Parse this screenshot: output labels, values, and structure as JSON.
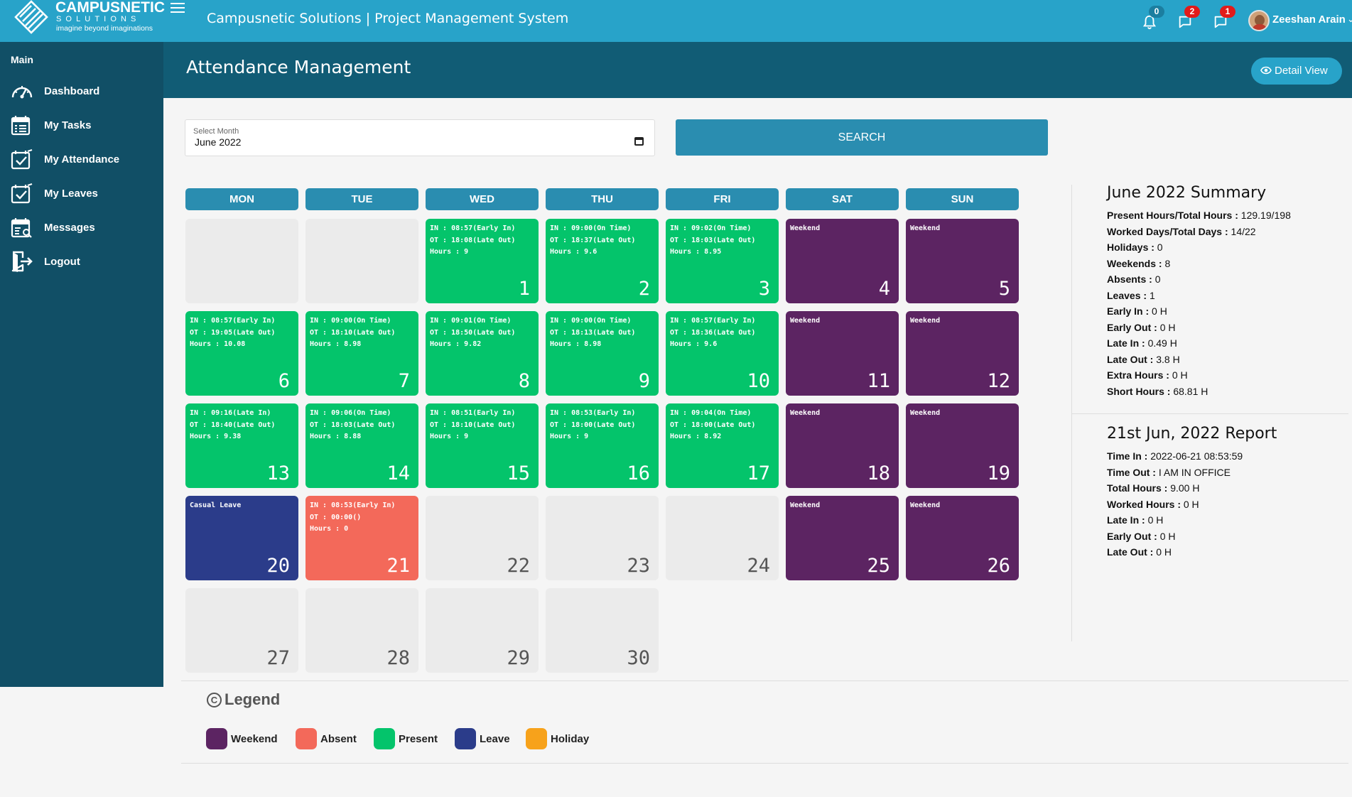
{
  "brand": {
    "name": "CAMPUSNETIC",
    "sub": "SOLUTIONS",
    "tagline": "imagine beyond imaginations"
  },
  "header": {
    "app_title": "Campusnetic Solutions | Project Management System",
    "notifications": [
      {
        "icon": "bell-icon",
        "count": "0",
        "color": "#1b7ea0"
      },
      {
        "icon": "chat-icon",
        "count": "2",
        "color": "#e21a1a"
      },
      {
        "icon": "chat-icon",
        "count": "1",
        "color": "#e21a1a"
      }
    ],
    "user_name": "Zeeshan Arain",
    "user_chevron": "⌄"
  },
  "sidebar": {
    "section": "Main",
    "items": [
      {
        "label": "Dashboard",
        "icon": "speedometer-icon"
      },
      {
        "label": "My Tasks",
        "icon": "calendar-list-icon"
      },
      {
        "label": "My Attendance",
        "icon": "calendar-check-icon"
      },
      {
        "label": "My Leaves",
        "icon": "calendar-check-icon"
      },
      {
        "label": "Messages",
        "icon": "calendar-search-icon"
      },
      {
        "label": "Logout",
        "icon": "logout-icon"
      }
    ]
  },
  "page": {
    "title": "Attendance Management",
    "detail_button": "Detail View"
  },
  "filter": {
    "month_label": "Select Month",
    "month_value": "June 2022",
    "search_label": "SEARCH"
  },
  "calendar": {
    "days": [
      "MON",
      "TUE",
      "WED",
      "THU",
      "FRI",
      "SAT",
      "SUN"
    ],
    "cells": [
      {
        "type": "empty",
        "day": "",
        "info": ""
      },
      {
        "type": "empty",
        "day": "",
        "info": ""
      },
      {
        "type": "present",
        "day": "1",
        "info": "IN : 08:57(Early In)\nOT : 18:08(Late Out)\nHours : 9"
      },
      {
        "type": "present",
        "day": "2",
        "info": "IN : 09:00(On Time)\nOT : 18:37(Late Out)\nHours : 9.6"
      },
      {
        "type": "present",
        "day": "3",
        "info": "IN : 09:02(On Time)\nOT : 18:03(Late Out)\nHours : 8.95"
      },
      {
        "type": "weekend",
        "day": "4",
        "info": "Weekend"
      },
      {
        "type": "weekend",
        "day": "5",
        "info": "Weekend"
      },
      {
        "type": "present",
        "day": "6",
        "info": "IN : 08:57(Early In)\nOT : 19:05(Late Out)\nHours : 10.08"
      },
      {
        "type": "present",
        "day": "7",
        "info": "IN : 09:00(On Time)\nOT : 18:10(Late Out)\nHours : 8.98"
      },
      {
        "type": "present",
        "day": "8",
        "info": "IN : 09:01(On Time)\nOT : 18:50(Late Out)\nHours : 9.82"
      },
      {
        "type": "present",
        "day": "9",
        "info": "IN : 09:00(On Time)\nOT : 18:13(Late Out)\nHours : 8.98"
      },
      {
        "type": "present",
        "day": "10",
        "info": "IN : 08:57(Early In)\nOT : 18:36(Late Out)\nHours : 9.6"
      },
      {
        "type": "weekend",
        "day": "11",
        "info": "Weekend"
      },
      {
        "type": "weekend",
        "day": "12",
        "info": "Weekend"
      },
      {
        "type": "present",
        "day": "13",
        "info": "IN : 09:16(Late In)\nOT : 18:40(Late Out)\nHours : 9.38"
      },
      {
        "type": "present",
        "day": "14",
        "info": "IN : 09:06(On Time)\nOT : 18:03(Late Out)\nHours : 8.88"
      },
      {
        "type": "present",
        "day": "15",
        "info": "IN : 08:51(Early In)\nOT : 18:10(Late Out)\nHours : 9"
      },
      {
        "type": "present",
        "day": "16",
        "info": "IN : 08:53(Early In)\nOT : 18:00(Late Out)\nHours : 9"
      },
      {
        "type": "present",
        "day": "17",
        "info": "IN : 09:04(On Time)\nOT : 18:00(Late Out)\nHours : 8.92"
      },
      {
        "type": "weekend",
        "day": "18",
        "info": "Weekend"
      },
      {
        "type": "weekend",
        "day": "19",
        "info": "Weekend"
      },
      {
        "type": "leave",
        "day": "20",
        "info": "Casual Leave"
      },
      {
        "type": "absent",
        "day": "21",
        "info": "IN : 08:53(Early In)\nOT : 00:00()\nHours : 0"
      },
      {
        "type": "future",
        "day": "22",
        "info": ""
      },
      {
        "type": "future",
        "day": "23",
        "info": ""
      },
      {
        "type": "future",
        "day": "24",
        "info": ""
      },
      {
        "type": "weekend",
        "day": "25",
        "info": "Weekend"
      },
      {
        "type": "weekend",
        "day": "26",
        "info": "Weekend"
      },
      {
        "type": "future",
        "day": "27",
        "info": ""
      },
      {
        "type": "future",
        "day": "28",
        "info": ""
      },
      {
        "type": "future",
        "day": "29",
        "info": ""
      },
      {
        "type": "future",
        "day": "30",
        "info": ""
      }
    ]
  },
  "summary": {
    "title": "June 2022 Summary",
    "rows": [
      {
        "label": "Present Hours/Total Hours :",
        "value": "129.19/198"
      },
      {
        "label": "Worked Days/Total Days :",
        "value": "14/22"
      },
      {
        "label": "Holidays :",
        "value": "0"
      },
      {
        "label": "Weekends :",
        "value": "8"
      },
      {
        "label": "Absents :",
        "value": "0"
      },
      {
        "label": "Leaves :",
        "value": "1"
      },
      {
        "label": "Early In :",
        "value": "0 H"
      },
      {
        "label": "Early Out :",
        "value": "0 H"
      },
      {
        "label": "Late In :",
        "value": "0.49 H"
      },
      {
        "label": "Late Out :",
        "value": "3.8 H"
      },
      {
        "label": "Extra Hours :",
        "value": "0 H"
      },
      {
        "label": "Short Hours :",
        "value": "68.81 H"
      }
    ]
  },
  "report": {
    "title": "21st Jun, 2022 Report",
    "rows": [
      {
        "label": "Time In :",
        "value": "2022-06-21 08:53:59"
      },
      {
        "label": "Time Out :",
        "value": "I AM IN OFFICE"
      },
      {
        "label": "Total Hours :",
        "value": "9.00 H"
      },
      {
        "label": "Worked Hours :",
        "value": "0 H"
      },
      {
        "label": "Late In :",
        "value": "0 H"
      },
      {
        "label": "Early Out :",
        "value": "0 H"
      },
      {
        "label": "Late Out :",
        "value": "0 H"
      }
    ]
  },
  "legend": {
    "title": "Legend",
    "symbol": "C",
    "items": [
      {
        "label": "Weekend",
        "color": "#5c2462"
      },
      {
        "label": "Absent",
        "color": "#f3695a"
      },
      {
        "label": "Present",
        "color": "#04c46b"
      },
      {
        "label": "Leave",
        "color": "#2b3c8a"
      },
      {
        "label": "Holiday",
        "color": "#f7a21b"
      }
    ]
  }
}
